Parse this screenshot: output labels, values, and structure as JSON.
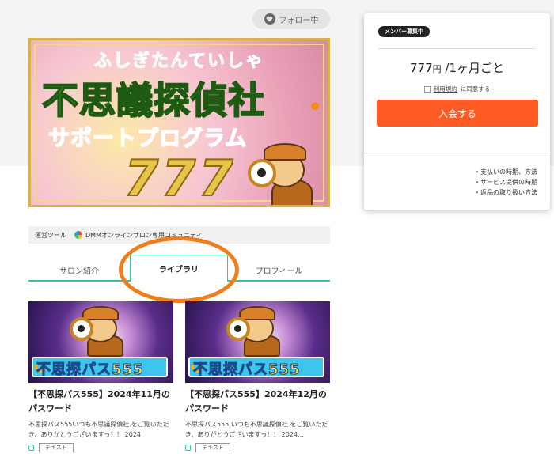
{
  "header": {
    "follow_label": "フォロー中"
  },
  "banner": {
    "reading": "ふしぎたんていしゃ",
    "title": "不思議探偵社",
    "subtitle": "サポートプログラム",
    "number": "777"
  },
  "tools": {
    "label": "運営ツール",
    "item": "DMMオンラインサロン専用コミュニティ"
  },
  "tabs": [
    {
      "label": "サロン紹介"
    },
    {
      "label": "ライブラリ"
    },
    {
      "label": "プロフィール"
    }
  ],
  "cards": [
    {
      "thumb_text": "不思探パス555",
      "title": "【不思探パス555】2024年11月のパスワード",
      "excerpt": "不思探パス555いつも不思議探偵社.をご覧いただき、ありがとうございますっ！！ 2024",
      "tag": "テキスト"
    },
    {
      "thumb_text": "不思探パス555",
      "title": "【不思探パス555】2024年12月のパスワード",
      "excerpt": "不思探パス555 いつも不思議探偵社.をご覧いただき、ありがとうございますっ！！ 2024...",
      "tag": "テキスト"
    }
  ],
  "panel": {
    "badge": "メンバー募集中",
    "price": "777",
    "price_unit": "円",
    "period": " /1ヶ月ごと",
    "terms_link": "利用規約",
    "terms_suffix": "に同意する",
    "join_label": "入会する",
    "links": [
      "・支払いの時期、方法",
      "・サービス提供の時期",
      "・返品の取り扱い方法"
    ]
  },
  "colors": {
    "accent_green": "#3cc39a",
    "join_orange": "#ff5a24",
    "annotation_orange": "#f07e1d"
  },
  "icons": [
    "heart-icon",
    "dmm-logo-icon",
    "lock-icon",
    "checkbox-icon",
    "key-icon"
  ]
}
